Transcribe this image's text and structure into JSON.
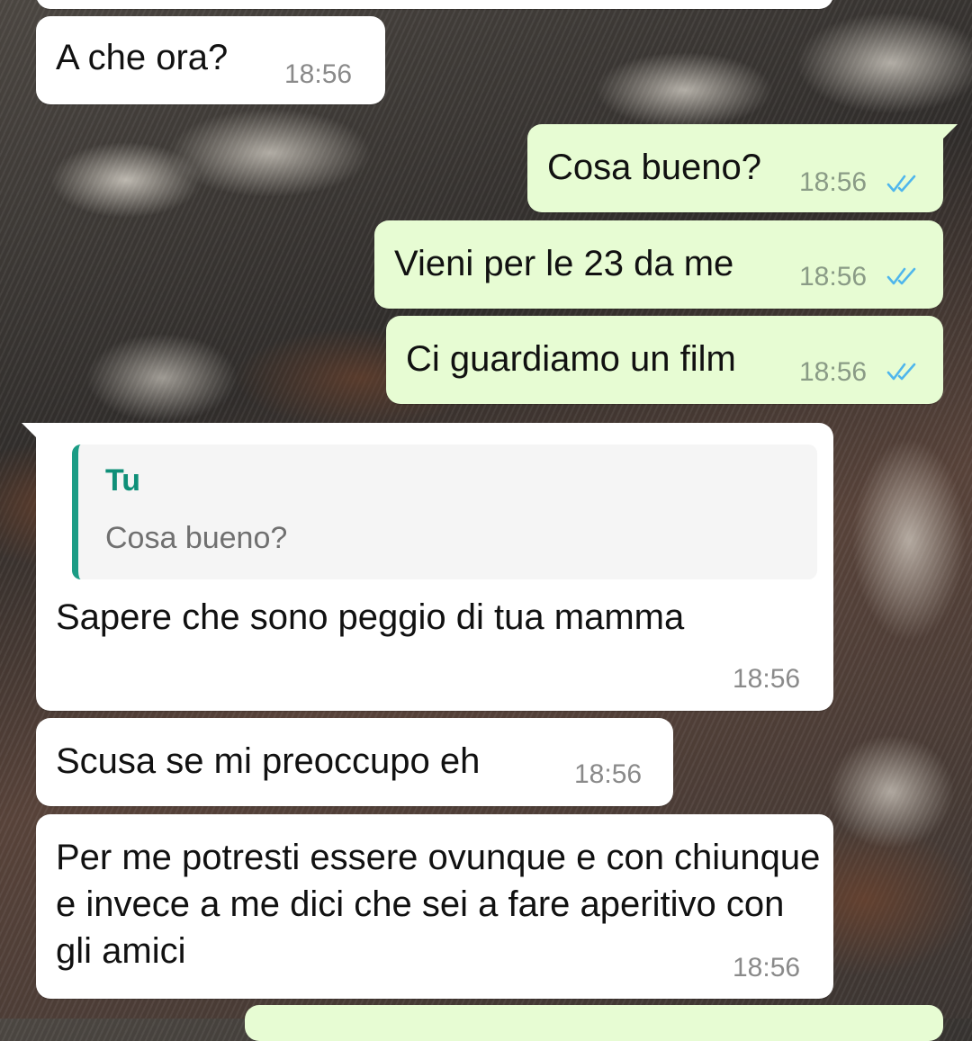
{
  "messages": [
    {
      "id": "m1",
      "direction": "incoming",
      "text": "A che ora?",
      "time": "18:56"
    },
    {
      "id": "m2",
      "direction": "outgoing",
      "text": "Cosa bueno?",
      "time": "18:56",
      "status": "read"
    },
    {
      "id": "m3",
      "direction": "outgoing",
      "text": "Vieni per le 23 da me",
      "time": "18:56",
      "status": "read"
    },
    {
      "id": "m4",
      "direction": "outgoing",
      "text": "Ci guardiamo un film",
      "time": "18:56",
      "status": "read"
    },
    {
      "id": "m5",
      "direction": "incoming",
      "reply_to": {
        "author": "Tu",
        "text": "Cosa bueno?"
      },
      "text": "Sapere che sono peggio di tua mamma",
      "time": "18:56"
    },
    {
      "id": "m6",
      "direction": "incoming",
      "text": "Scusa se mi preoccupo eh",
      "time": "18:56"
    },
    {
      "id": "m7",
      "direction": "incoming",
      "text": "Per me potresti essere ovunque e con chiunque e invece a me dici che sei a fare aperitivo con gli amici",
      "time": "18:56"
    }
  ],
  "colors": {
    "incoming_bubble": "#ffffff",
    "outgoing_bubble": "#e7fcd3",
    "read_ticks": "#4fb6ec",
    "quote_accent": "#1b9c85"
  },
  "icons": {
    "read_status": "double-check-icon"
  }
}
